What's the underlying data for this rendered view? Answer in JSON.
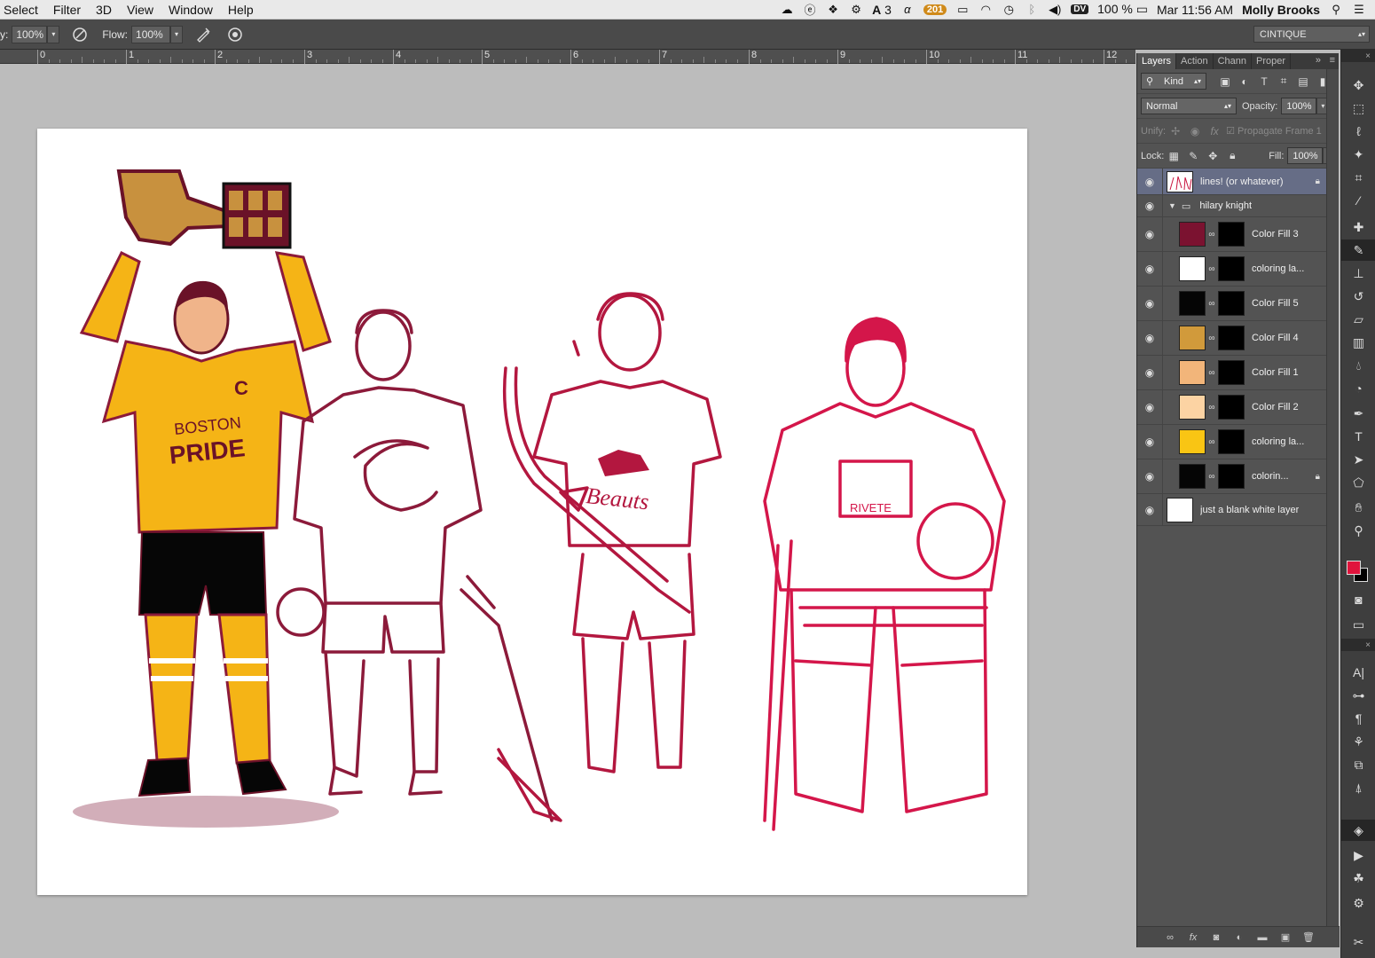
{
  "menubar": {
    "menus": [
      "Select",
      "Filter",
      "3D",
      "View",
      "Window",
      "Help"
    ],
    "status": {
      "adobe_count": "3",
      "mail_badge": "201",
      "dv": "DV",
      "battery": "100 %",
      "clock": "Mar 11:56 AM",
      "user": "Molly Brooks"
    }
  },
  "options": {
    "opacity_label": "y:",
    "opacity_value": "100%",
    "flow_label": "Flow:",
    "flow_value": "100%",
    "workspace": "CINTIQUE"
  },
  "ruler": {
    "labels": [
      "0",
      "1",
      "2",
      "3",
      "4",
      "5",
      "6",
      "7",
      "8",
      "9",
      "10",
      "11",
      "12"
    ]
  },
  "panel": {
    "tabs": [
      "Layers",
      "Action",
      "Chann",
      "Proper"
    ],
    "kind_label": "Kind",
    "blend_mode": "Normal",
    "opacity_label": "Opacity:",
    "opacity_value": "100%",
    "unify_label": "Unify:",
    "propagate_label": "Propagate Frame 1",
    "lock_label": "Lock:",
    "fill_label": "Fill:",
    "fill_value": "100%"
  },
  "layers": [
    {
      "name": "lines! (or whatever)",
      "kind": "pixel",
      "locked": true,
      "selected": true
    },
    {
      "name": "hilary knight",
      "kind": "group"
    },
    {
      "name": "Color Fill 3",
      "kind": "fill",
      "color": "#7b1230"
    },
    {
      "name": "coloring la...",
      "kind": "fill",
      "color": "#ffffff"
    },
    {
      "name": "Color Fill 5",
      "kind": "fill",
      "color": "#050505"
    },
    {
      "name": "Color Fill 4",
      "kind": "fill",
      "color": "#d19a3b"
    },
    {
      "name": "Color Fill 1",
      "kind": "fill",
      "color": "#f2b57a"
    },
    {
      "name": "Color Fill 2",
      "kind": "fill",
      "color": "#fcd3a3"
    },
    {
      "name": "coloring la...",
      "kind": "fill",
      "color": "#f9c514"
    },
    {
      "name": "colorin...",
      "kind": "fill",
      "color": "#050505",
      "locked": true
    },
    {
      "name": "just a blank white layer",
      "kind": "background",
      "color": "#ffffff"
    }
  ],
  "colors": {
    "foreground": "#e0143c",
    "background": "#000000",
    "line_maroon": "#8c1a3a",
    "line_crimson": "#d4164a",
    "jersey_gold": "#f5b416"
  },
  "artwork": {
    "jersey_text_1": "BOSTON",
    "jersey_text_2": "PRIDE",
    "captain_letter": "C",
    "jersey_text_3": "Beauts",
    "jersey_text_4": "RIVETE"
  }
}
